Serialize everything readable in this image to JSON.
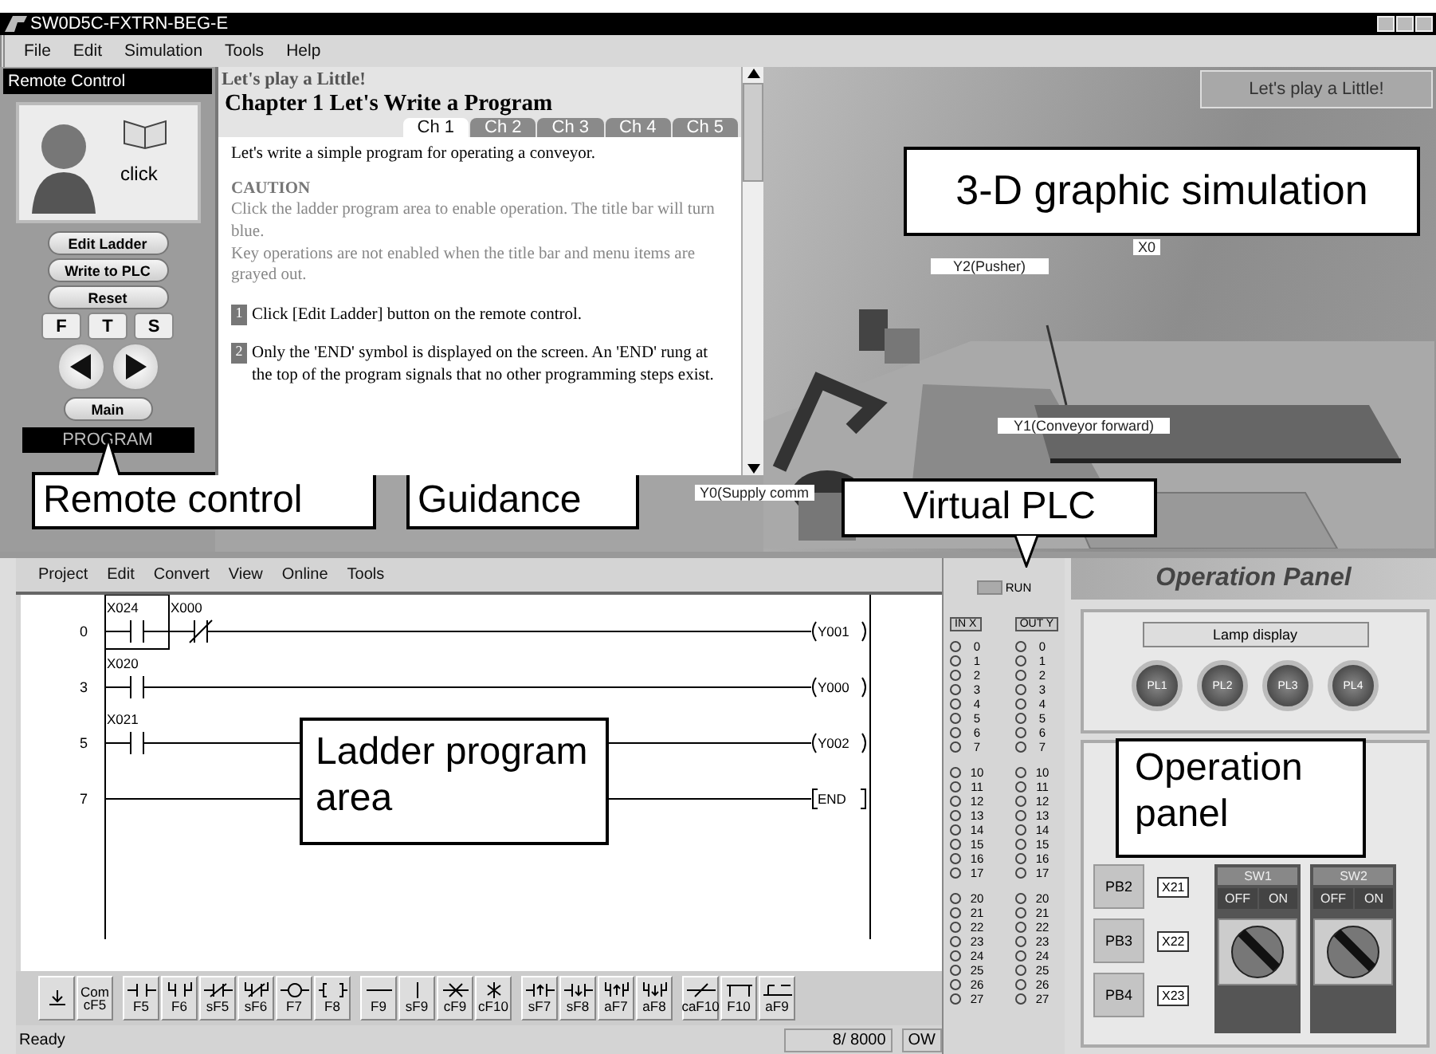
{
  "window": {
    "title": "SW0D5C-FXTRN-BEG-E"
  },
  "menu": [
    "File",
    "Edit",
    "Simulation",
    "Tools",
    "Help"
  ],
  "remote_control": {
    "title": "Remote Control",
    "click_label": "click",
    "buttons": [
      "Edit Ladder",
      "Write to PLC",
      "Reset"
    ],
    "mode_keys": [
      "F",
      "T",
      "S"
    ],
    "main_button": "Main",
    "mode": "PROGRAM"
  },
  "guidance": {
    "header": "Let's play a Little!",
    "chapter": "Chapter 1  Let's Write a Program",
    "tabs": [
      {
        "label": "Ch 1",
        "selected": true
      },
      {
        "label": "Ch 2",
        "selected": false
      },
      {
        "label": "Ch 3",
        "selected": false
      },
      {
        "label": "Ch 4",
        "selected": false
      },
      {
        "label": "Ch 5",
        "selected": false
      }
    ],
    "intro": "Let's write a simple program for operating a conveyor.",
    "caution_title": "CAUTION",
    "caution_lines": [
      "Click the ladder program area to enable operation. The title bar will turn blue.",
      "Key operations are not enabled when the title bar and menu items are grayed out."
    ],
    "steps": [
      {
        "number": "1",
        "text": "Click [Edit Ladder] button on the remote control."
      },
      {
        "number": "2",
        "text": "Only the 'END' symbol is displayed on the screen. An 'END' rung at the top of the program signals that no other programming steps exist."
      }
    ]
  },
  "simulation": {
    "badge": "Let's play a Little!",
    "labels": [
      "X0",
      "Y2(Pusher)",
      "Y1(Conveyor forward)",
      "Y0(Supply comm"
    ]
  },
  "ladder": {
    "menu": [
      "Project",
      "Edit",
      "Convert",
      "View",
      "Online",
      "Tools"
    ],
    "rungs": [
      {
        "step": "0",
        "kind": "coil",
        "output": "Y001",
        "contacts": [
          {
            "label": "X024",
            "kind": "no",
            "selected": true
          },
          {
            "label": "X000",
            "kind": "nc",
            "selected": false
          }
        ]
      },
      {
        "step": "3",
        "kind": "coil",
        "output": "Y000",
        "contacts": [
          {
            "label": "X020",
            "kind": "no",
            "selected": false
          }
        ]
      },
      {
        "step": "5",
        "kind": "coil",
        "output": "Y002",
        "contacts": [
          {
            "label": "X021",
            "kind": "no",
            "selected": false
          }
        ]
      },
      {
        "step": "7",
        "kind": "end",
        "output": "END"
      }
    ],
    "toolbar_groups": [
      [
        {
          "kind": "convert"
        },
        {
          "kind": "comment",
          "keys": [
            "Com",
            "cF5"
          ]
        }
      ],
      [
        {
          "kind": "contact",
          "keys": [
            "F5"
          ]
        },
        {
          "kind": "parallel",
          "keys": [
            "F6"
          ]
        },
        {
          "kind": "contact_nc",
          "keys": [
            "sF5"
          ]
        },
        {
          "kind": "parallel_nc",
          "keys": [
            "sF6"
          ]
        },
        {
          "kind": "coil",
          "keys": [
            "F7"
          ]
        },
        {
          "kind": "instruction",
          "keys": [
            "F8"
          ]
        }
      ],
      [
        {
          "kind": "hline",
          "keys": [
            "F9"
          ]
        },
        {
          "kind": "vline",
          "keys": [
            "sF9"
          ]
        },
        {
          "kind": "hdelete",
          "keys": [
            "cF9"
          ]
        },
        {
          "kind": "vdelete",
          "keys": [
            "cF10"
          ]
        }
      ],
      [
        {
          "kind": "rise",
          "keys": [
            "sF7"
          ]
        },
        {
          "kind": "fall",
          "keys": [
            "sF8"
          ]
        },
        {
          "kind": "par_rise",
          "keys": [
            "aF7"
          ]
        },
        {
          "kind": "par_fall",
          "keys": [
            "aF8"
          ]
        }
      ],
      [
        {
          "kind": "invert",
          "keys": [
            "caF10"
          ]
        },
        {
          "kind": "edge",
          "keys": [
            "F10"
          ]
        },
        {
          "kind": "pulse",
          "keys": [
            "aF9"
          ]
        }
      ]
    ]
  },
  "status_bar": {
    "text": "Ready",
    "steps": "8/ 8000",
    "mode": "OW"
  },
  "plc": {
    "run_label": "RUN",
    "inputs_header": "IN X",
    "outputs_header": "OUT Y",
    "inputs": [
      [
        "0",
        "1",
        "2",
        "3",
        "4",
        "5",
        "6",
        "7"
      ],
      [
        "10",
        "11",
        "12",
        "13",
        "14",
        "15",
        "16",
        "17"
      ],
      [
        "20",
        "21",
        "22",
        "23",
        "24",
        "25",
        "26",
        "27"
      ]
    ],
    "outputs": [
      [
        "0",
        "1",
        "2",
        "3",
        "4",
        "5",
        "6",
        "7"
      ],
      [
        "10",
        "11",
        "12",
        "13",
        "14",
        "15",
        "16",
        "17"
      ],
      [
        "20",
        "21",
        "22",
        "23",
        "24",
        "25",
        "26",
        "27"
      ]
    ]
  },
  "operation_panel": {
    "title": "Operation Panel",
    "lamp_display": "Lamp display",
    "lamps": [
      "PL1",
      "PL2",
      "PL3",
      "PL4"
    ],
    "push_buttons": [
      {
        "label": "PB2",
        "address": "X21"
      },
      {
        "label": "PB3",
        "address": "X22"
      },
      {
        "label": "PB4",
        "address": "X23"
      }
    ],
    "switches": [
      {
        "label": "SW1",
        "off": "OFF",
        "on": "ON",
        "switched_on": false
      },
      {
        "label": "SW2",
        "off": "OFF",
        "on": "ON",
        "switched_on": false
      }
    ]
  },
  "callouts": [
    "Remote control",
    "Guidance",
    "3-D graphic simulation",
    "Virtual PLC",
    "Ladder program area",
    "Operation panel"
  ]
}
